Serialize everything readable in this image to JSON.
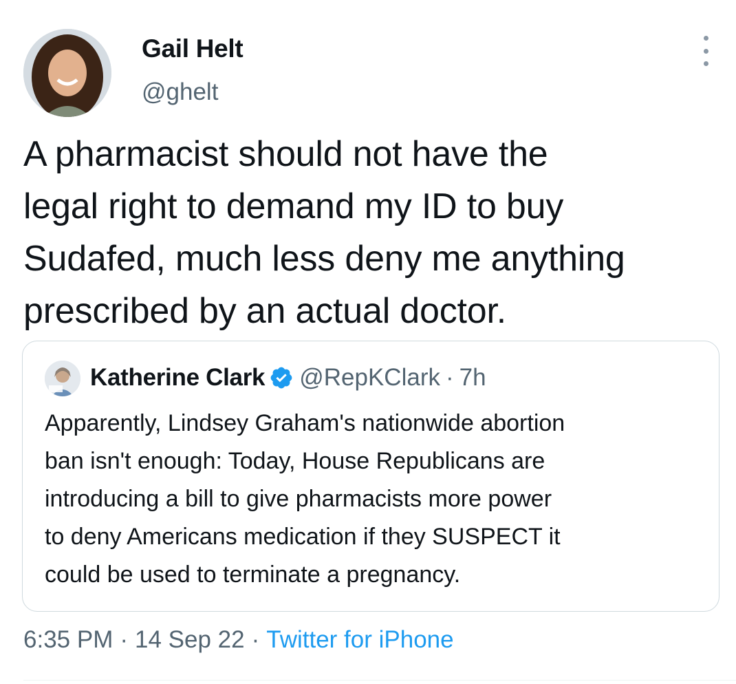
{
  "tweet": {
    "author": {
      "display_name": "Gail Helt",
      "handle": "@ghelt"
    },
    "text": "A pharmacist should not have the\nlegal right to demand my ID to buy\nSudafed, much less deny me anything\nprescribed by an actual doctor.",
    "quoted_tweet": {
      "author_name": "Katherine Clark",
      "verified": true,
      "handle": "@RepKClark",
      "separator": "·",
      "time_ago": "7h",
      "text": "Apparently, Lindsey Graham's nationwide abortion\nban isn't enough: Today, House Republicans are\nintroducing a bill to give pharmacists more power\nto deny Americans medication if they SUSPECT it\ncould be used to terminate a pregnancy."
    },
    "meta": {
      "time": "6:35 PM",
      "date": "14 Sep 22",
      "source": "Twitter for iPhone",
      "separator": "·"
    }
  },
  "icons": {
    "more": "more-vertical-icon",
    "verified": "verified-badge-icon"
  },
  "colors": {
    "text": "#0f1419",
    "secondary": "#536471",
    "link": "#1d9bf0",
    "verified": "#1d9bf0",
    "border": "#cfd9de"
  }
}
